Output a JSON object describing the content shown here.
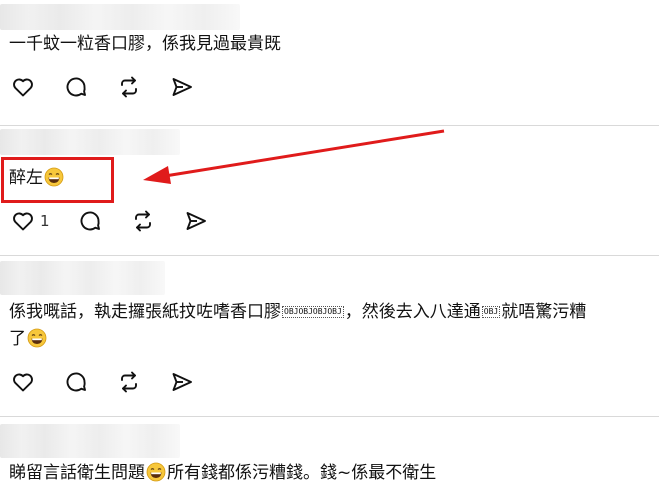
{
  "posts": [
    {
      "text": "一千蚊一粒香口膠，係我見過最貴既"
    },
    {
      "text": "醉左",
      "like_count": "1"
    },
    {
      "text_a": "係我嘅話，執走攞張紙抆咗嗜香口膠",
      "obj1": "OBJOBJOBJOBJ",
      "text_b": "，然後去入八達通",
      "obj2": "OBJ",
      "text_c": "就唔驚污糟",
      "text_d": "了"
    },
    {
      "text_a": "睇留言話衛生問題",
      "text_b": "所有錢都係污糟錢。錢~係最不衛生"
    }
  ],
  "icons": [
    "heart-icon",
    "comment-icon",
    "repost-icon",
    "share-icon"
  ],
  "colors": {
    "annotation": "#e01b1b",
    "divider": "#d9d9d9",
    "text": "#111111"
  }
}
